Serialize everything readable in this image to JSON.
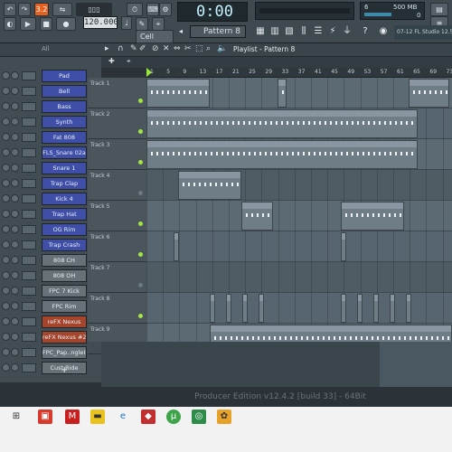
{
  "toolbar": {
    "time": "0:00",
    "time_suffix": "00",
    "tempo": "120.000",
    "pattern": "Pattern 8",
    "snap": "Cell",
    "memory_value": "500 MB",
    "memory_num": "6",
    "memory_num2": "0",
    "news": "07-12  FL Studio 12.5",
    "record_label": "REC",
    "mode_label": "3.2"
  },
  "rack": {
    "filter": "All",
    "add_label": "+",
    "channels": [
      {
        "name": "Pad",
        "color": "blue"
      },
      {
        "name": "Bell",
        "color": "blue"
      },
      {
        "name": "Bass",
        "color": "blue"
      },
      {
        "name": "Synth",
        "color": "blue"
      },
      {
        "name": "Fat 808",
        "color": "blue"
      },
      {
        "name": "FLS_Snare 02a",
        "color": "blue"
      },
      {
        "name": "Snare 1",
        "color": "blue"
      },
      {
        "name": "Trap Clap",
        "color": "blue"
      },
      {
        "name": "Kick 4",
        "color": "blue"
      },
      {
        "name": "Trap Hat",
        "color": "blue"
      },
      {
        "name": "OG Rim",
        "color": "blue"
      },
      {
        "name": "Trap Crash",
        "color": "blue"
      },
      {
        "name": "808 CH",
        "color": "grey"
      },
      {
        "name": "808 OH",
        "color": "grey"
      },
      {
        "name": "FPC 7 Kick",
        "color": "grey"
      },
      {
        "name": "FPC Rim",
        "color": "grey"
      },
      {
        "name": "reFX Nexus",
        "color": "red"
      },
      {
        "name": "reFX Nexus #2",
        "color": "red"
      },
      {
        "name": "FPC_Pap..ngleII",
        "color": "grey"
      },
      {
        "name": "Cust Ride",
        "color": "grey"
      }
    ]
  },
  "playlist": {
    "title": "Playlist - Pattern 8",
    "ruler_marks": [
      "1",
      "5",
      "9",
      "13",
      "17",
      "21",
      "25",
      "29",
      "33",
      "37",
      "41",
      "45",
      "49",
      "53",
      "57",
      "61",
      "65",
      "69",
      "73"
    ],
    "tracks": [
      "Track 1",
      "Track 2",
      "Track 3",
      "Track 4",
      "Track 5",
      "Track 6",
      "Track 7",
      "Track 8",
      "Track 9"
    ]
  },
  "status": {
    "edition": "Producer Edition v12.4.2 [build 33] - 64Bit"
  },
  "colors": {
    "accent_green": "#9be63b",
    "channel_blue": "#3f4fa8",
    "channel_red": "#a5452c",
    "record_orange": "#e5611d"
  }
}
